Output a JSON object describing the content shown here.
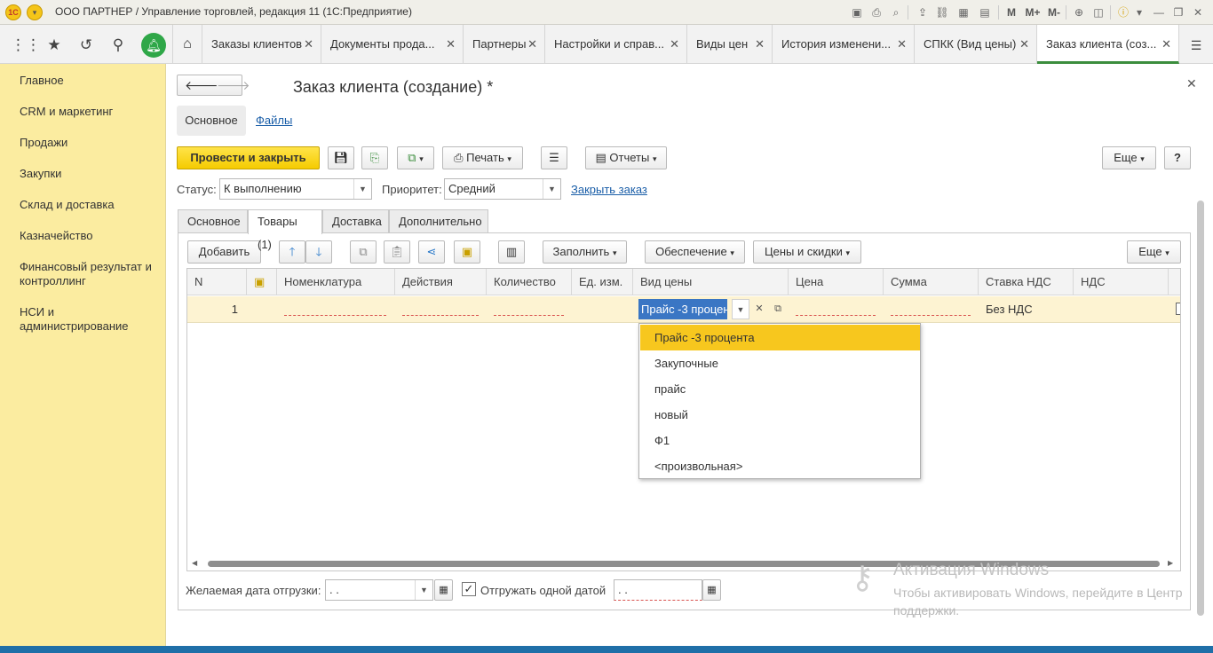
{
  "window": {
    "title": "ООО ПАРТНЕР / Управление торговлей, редакция 11  (1С:Предприятие)",
    "toolbar_labels": [
      "M",
      "M+",
      "M-"
    ]
  },
  "open_tabs": [
    {
      "label": "Заказы клиентов"
    },
    {
      "label": "Документы прода..."
    },
    {
      "label": "Партнеры"
    },
    {
      "label": "Настройки и справ..."
    },
    {
      "label": "Виды цен"
    },
    {
      "label": "История изменени..."
    },
    {
      "label": "СПКК (Вид цены)"
    },
    {
      "label": "Заказ клиента (соз..."
    }
  ],
  "sidebar": {
    "items": [
      {
        "label": "Главное"
      },
      {
        "label": "CRM и маркетинг"
      },
      {
        "label": "Продажи"
      },
      {
        "label": "Закупки"
      },
      {
        "label": "Склад и доставка"
      },
      {
        "label": "Казначейство"
      },
      {
        "label": "Финансовый результат и контроллинг"
      },
      {
        "label": "НСИ и администрирование"
      }
    ]
  },
  "form": {
    "title": "Заказ клиента (создание) *",
    "nav": {
      "main": "Основное",
      "files": "Файлы"
    },
    "toolbar": {
      "post_close": "Провести и закрыть",
      "print": "Печать",
      "reports": "Отчеты",
      "more": "Еще",
      "help": "?"
    },
    "status": {
      "label": "Статус:",
      "value": "К выполнению"
    },
    "priority": {
      "label": "Приоритет:",
      "value": "Средний"
    },
    "close_order": "Закрыть заказ",
    "tabs": [
      "Основное",
      "Товары (1)",
      "Доставка",
      "Дополнительно"
    ],
    "goods_toolbar": {
      "add": "Добавить",
      "fill": "Заполнить",
      "provision": "Обеспечение",
      "prices": "Цены и скидки",
      "more": "Еще"
    },
    "table": {
      "columns": [
        "N",
        "",
        "Номенклатура",
        "Действия",
        "Количество",
        "Ед. изм.",
        "Вид цены",
        "Цена",
        "Сумма",
        "Ставка НДС",
        "НДС"
      ],
      "rows": [
        {
          "n": "1",
          "price_type": "Прайс -3 процен",
          "vat_rate": "Без НДС"
        }
      ]
    },
    "dropdown": {
      "items": [
        "Прайс -3 процента",
        "Закупочные",
        "прайс",
        "новый",
        "Ф1",
        "<произвольная>"
      ],
      "selected_index": 0
    },
    "footer": {
      "ship_date_label": "Желаемая дата отгрузки:",
      "ship_date_value": " .  .",
      "ship_one_date_label": "Отгружать одной датой",
      "ship_one_date_checked": true,
      "ship_one_date_value": " .  ."
    }
  },
  "watermark": {
    "title": "Активация Windows",
    "text": "Чтобы активировать Windows, перейдите в Центр поддержки."
  },
  "colors": {
    "sidebar": "#fbeca0",
    "primary_button": "#f5cb00",
    "selected_row": "#fdf3d2",
    "dropdown_highlight": "#f7c71e",
    "notification": "#2fa748"
  }
}
